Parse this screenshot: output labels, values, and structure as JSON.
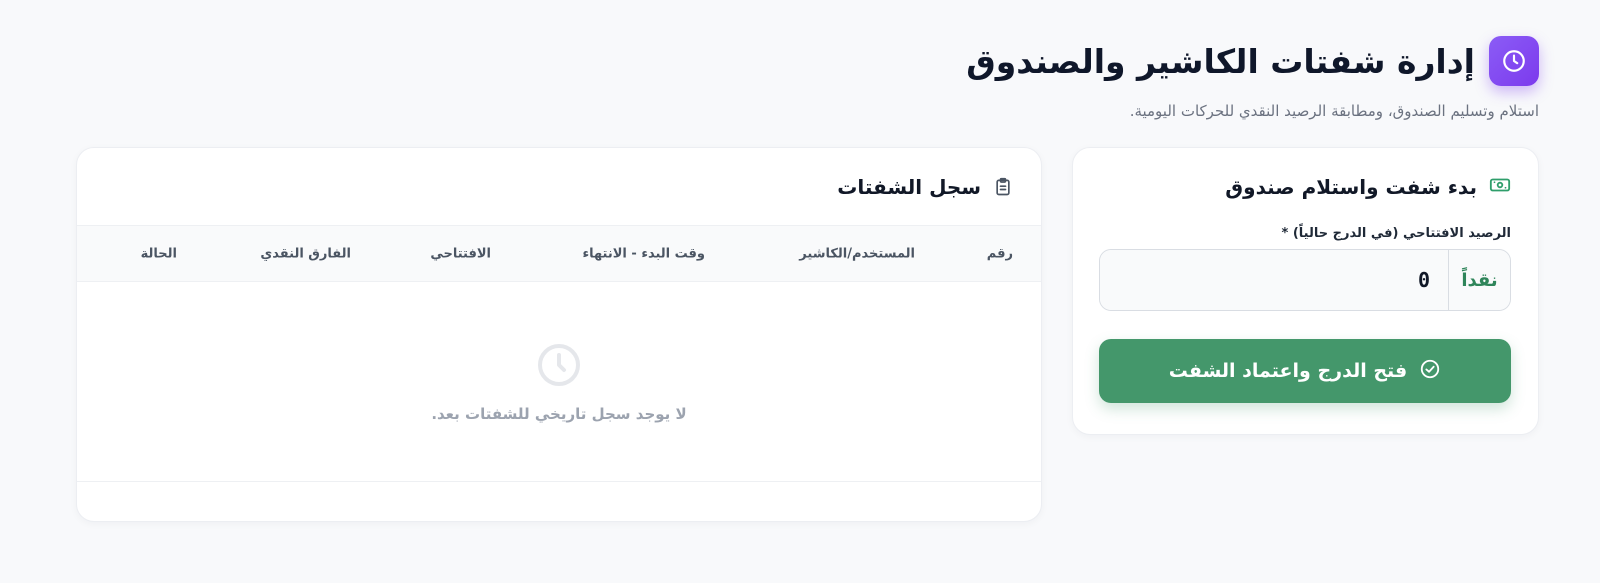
{
  "header": {
    "title": "إدارة شفتات الكاشير والصندوق",
    "subtitle": "استلام وتسليم الصندوق، ومطابقة الرصيد النقدي للحركات اليومية.",
    "icon": "clock-icon",
    "accent": "#7c3aed"
  },
  "start_shift": {
    "title": "بدء شفت واستلام صندوق",
    "icon": "cash-icon",
    "opening_label": "الرصيد الافتتاحي (في الدرج حالياً) *",
    "currency_addon": "نقداً",
    "opening_value": "0",
    "submit_label": "فتح الدرج واعتماد الشفت",
    "submit_icon": "check-circle-icon",
    "button_color": "#44976b"
  },
  "history": {
    "title": "سجل الشفتات",
    "icon": "clipboard-icon",
    "columns": [
      "رقم",
      "المستخدم/الكاشير",
      "وقت البدء - الانتهاء",
      "الافتتاحي",
      "الفارق النقدي",
      "الحالة"
    ],
    "empty_icon": "clock-icon",
    "empty_message": "لا يوجد سجل تاريخي للشفتات بعد."
  }
}
